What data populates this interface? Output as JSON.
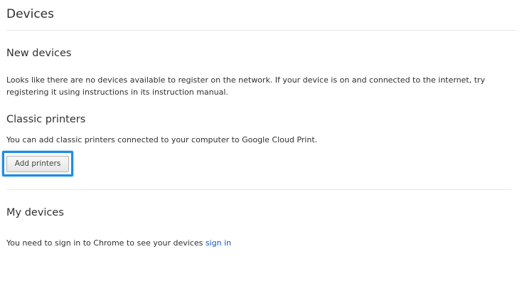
{
  "page": {
    "title": "Devices"
  },
  "new_devices": {
    "heading": "New devices",
    "description": "Looks like there are no devices available to register on the network. If your device is on and connected to the internet, try registering it using instructions in its instruction manual."
  },
  "classic_printers": {
    "heading": "Classic printers",
    "description": "You can add classic printers connected to your computer to Google Cloud Print.",
    "add_button_label": "Add printers"
  },
  "my_devices": {
    "heading": "My devices",
    "description": "You need to sign in to Chrome to see your devices",
    "sign_in_link": "sign in"
  },
  "colors": {
    "link": "#1155cc",
    "focus_ring": "#1e8be6",
    "text": "#303030",
    "divider": "#e8e8e8"
  }
}
